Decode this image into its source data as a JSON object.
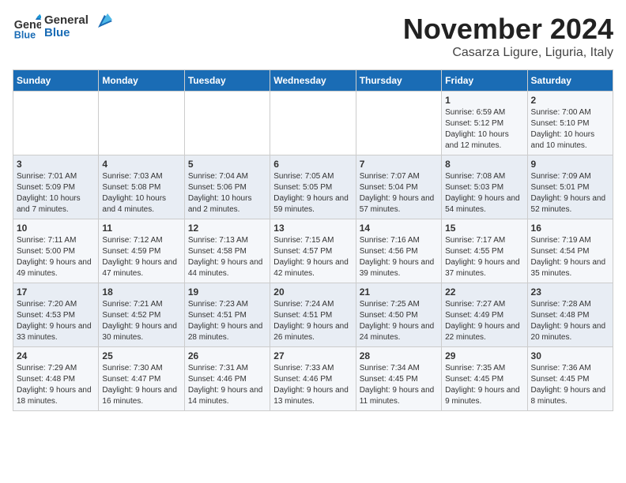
{
  "header": {
    "logo_line1": "General",
    "logo_line2": "Blue",
    "month_year": "November 2024",
    "location": "Casarza Ligure, Liguria, Italy"
  },
  "days_of_week": [
    "Sunday",
    "Monday",
    "Tuesday",
    "Wednesday",
    "Thursday",
    "Friday",
    "Saturday"
  ],
  "weeks": [
    [
      {
        "day": "",
        "content": ""
      },
      {
        "day": "",
        "content": ""
      },
      {
        "day": "",
        "content": ""
      },
      {
        "day": "",
        "content": ""
      },
      {
        "day": "",
        "content": ""
      },
      {
        "day": "1",
        "content": "Sunrise: 6:59 AM\nSunset: 5:12 PM\nDaylight: 10 hours and 12 minutes."
      },
      {
        "day": "2",
        "content": "Sunrise: 7:00 AM\nSunset: 5:10 PM\nDaylight: 10 hours and 10 minutes."
      }
    ],
    [
      {
        "day": "3",
        "content": "Sunrise: 7:01 AM\nSunset: 5:09 PM\nDaylight: 10 hours and 7 minutes."
      },
      {
        "day": "4",
        "content": "Sunrise: 7:03 AM\nSunset: 5:08 PM\nDaylight: 10 hours and 4 minutes."
      },
      {
        "day": "5",
        "content": "Sunrise: 7:04 AM\nSunset: 5:06 PM\nDaylight: 10 hours and 2 minutes."
      },
      {
        "day": "6",
        "content": "Sunrise: 7:05 AM\nSunset: 5:05 PM\nDaylight: 9 hours and 59 minutes."
      },
      {
        "day": "7",
        "content": "Sunrise: 7:07 AM\nSunset: 5:04 PM\nDaylight: 9 hours and 57 minutes."
      },
      {
        "day": "8",
        "content": "Sunrise: 7:08 AM\nSunset: 5:03 PM\nDaylight: 9 hours and 54 minutes."
      },
      {
        "day": "9",
        "content": "Sunrise: 7:09 AM\nSunset: 5:01 PM\nDaylight: 9 hours and 52 minutes."
      }
    ],
    [
      {
        "day": "10",
        "content": "Sunrise: 7:11 AM\nSunset: 5:00 PM\nDaylight: 9 hours and 49 minutes."
      },
      {
        "day": "11",
        "content": "Sunrise: 7:12 AM\nSunset: 4:59 PM\nDaylight: 9 hours and 47 minutes."
      },
      {
        "day": "12",
        "content": "Sunrise: 7:13 AM\nSunset: 4:58 PM\nDaylight: 9 hours and 44 minutes."
      },
      {
        "day": "13",
        "content": "Sunrise: 7:15 AM\nSunset: 4:57 PM\nDaylight: 9 hours and 42 minutes."
      },
      {
        "day": "14",
        "content": "Sunrise: 7:16 AM\nSunset: 4:56 PM\nDaylight: 9 hours and 39 minutes."
      },
      {
        "day": "15",
        "content": "Sunrise: 7:17 AM\nSunset: 4:55 PM\nDaylight: 9 hours and 37 minutes."
      },
      {
        "day": "16",
        "content": "Sunrise: 7:19 AM\nSunset: 4:54 PM\nDaylight: 9 hours and 35 minutes."
      }
    ],
    [
      {
        "day": "17",
        "content": "Sunrise: 7:20 AM\nSunset: 4:53 PM\nDaylight: 9 hours and 33 minutes."
      },
      {
        "day": "18",
        "content": "Sunrise: 7:21 AM\nSunset: 4:52 PM\nDaylight: 9 hours and 30 minutes."
      },
      {
        "day": "19",
        "content": "Sunrise: 7:23 AM\nSunset: 4:51 PM\nDaylight: 9 hours and 28 minutes."
      },
      {
        "day": "20",
        "content": "Sunrise: 7:24 AM\nSunset: 4:51 PM\nDaylight: 9 hours and 26 minutes."
      },
      {
        "day": "21",
        "content": "Sunrise: 7:25 AM\nSunset: 4:50 PM\nDaylight: 9 hours and 24 minutes."
      },
      {
        "day": "22",
        "content": "Sunrise: 7:27 AM\nSunset: 4:49 PM\nDaylight: 9 hours and 22 minutes."
      },
      {
        "day": "23",
        "content": "Sunrise: 7:28 AM\nSunset: 4:48 PM\nDaylight: 9 hours and 20 minutes."
      }
    ],
    [
      {
        "day": "24",
        "content": "Sunrise: 7:29 AM\nSunset: 4:48 PM\nDaylight: 9 hours and 18 minutes."
      },
      {
        "day": "25",
        "content": "Sunrise: 7:30 AM\nSunset: 4:47 PM\nDaylight: 9 hours and 16 minutes."
      },
      {
        "day": "26",
        "content": "Sunrise: 7:31 AM\nSunset: 4:46 PM\nDaylight: 9 hours and 14 minutes."
      },
      {
        "day": "27",
        "content": "Sunrise: 7:33 AM\nSunset: 4:46 PM\nDaylight: 9 hours and 13 minutes."
      },
      {
        "day": "28",
        "content": "Sunrise: 7:34 AM\nSunset: 4:45 PM\nDaylight: 9 hours and 11 minutes."
      },
      {
        "day": "29",
        "content": "Sunrise: 7:35 AM\nSunset: 4:45 PM\nDaylight: 9 hours and 9 minutes."
      },
      {
        "day": "30",
        "content": "Sunrise: 7:36 AM\nSunset: 4:45 PM\nDaylight: 9 hours and 8 minutes."
      }
    ]
  ]
}
